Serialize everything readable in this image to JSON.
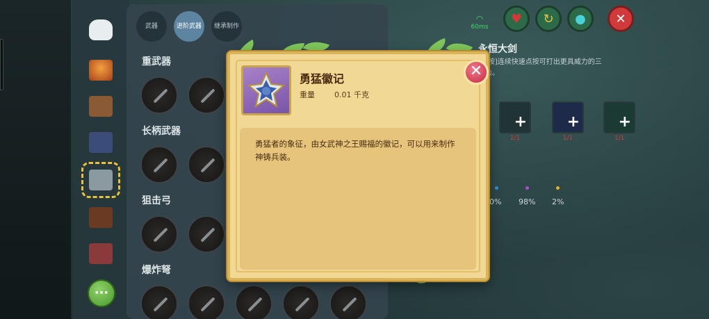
{
  "modal": {
    "item_name": "勇猛徽记",
    "weight_label": "重量",
    "weight_value": "0.01 千克",
    "description": "勇猛者的象征，由女武神之王赐福的徽记，可以用来制作神铸兵装。",
    "icon": "emblem-icon",
    "close_icon": "close-icon"
  },
  "tabs": [
    {
      "label": "武器",
      "active": false
    },
    {
      "label": "进阶武器",
      "active": true
    },
    {
      "label": "继承制作",
      "active": false
    }
  ],
  "sections": [
    {
      "title": "重武器"
    },
    {
      "title": "长柄武器"
    },
    {
      "title": "狙击弓"
    },
    {
      "title": "爆炸弩"
    }
  ],
  "right_panel": {
    "title": "永恒大剑",
    "description": "[点按]连续快速点按可打出更具威力的三连击。",
    "materials": [
      {
        "count": "1/1"
      },
      {
        "count": "1/1"
      },
      {
        "count": "1/1"
      }
    ],
    "percentages": [
      "0%",
      "98%",
      "2%"
    ]
  },
  "hud": {
    "signal_label": "60ms",
    "buttons": [
      "heart-icon",
      "arrow-icon",
      "drop-icon",
      "close-icon"
    ]
  },
  "more_button_label": "···",
  "colors": {
    "modal_bg": "#f1d894",
    "accent_gold": "#d9b45a",
    "close_red": "#c42a44"
  }
}
